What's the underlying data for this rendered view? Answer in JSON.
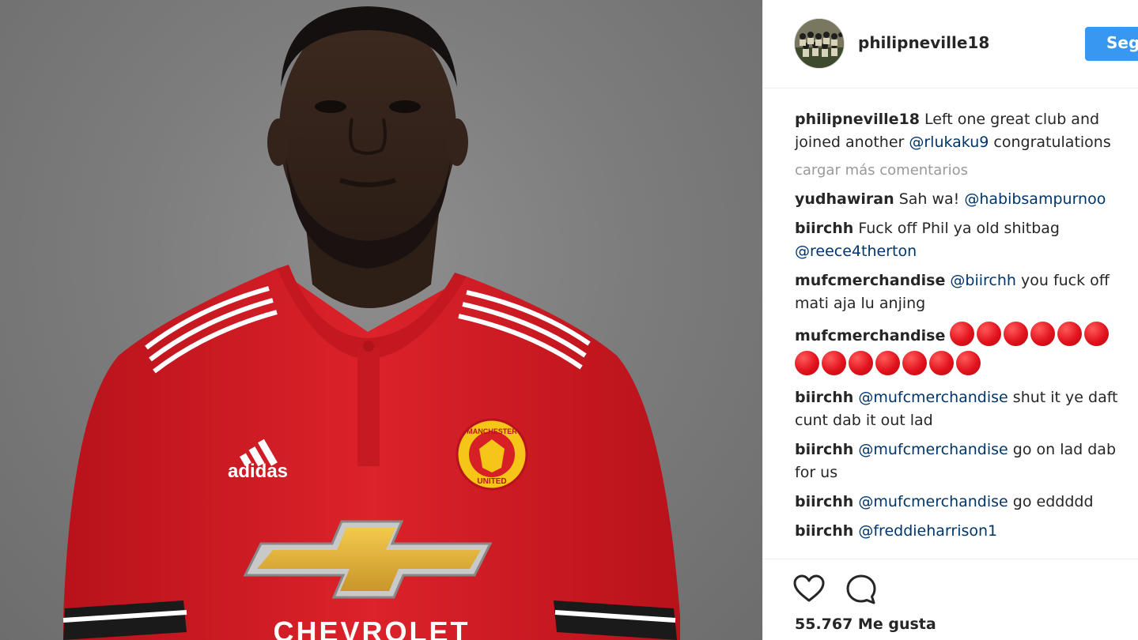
{
  "post": {
    "username": "philipneville18",
    "follow_label": "Seguir",
    "caption_text": " Left one great club and joined another ",
    "caption_mention": "@rlukaku9",
    "caption_tail": " congratulations",
    "load_more": "cargar más comentarios",
    "likes": "55.767 Me gusta"
  },
  "photo": {
    "shirt_brand": "adidas",
    "sponsor": "CHEVROLET",
    "crest_top": "MANCHESTER",
    "crest_bottom": "UNITED"
  },
  "comments": [
    {
      "user": "yudhawiran",
      "text": "Sah wa! ",
      "mention": "@habibsampurnoo",
      "tail": ""
    },
    {
      "user": "biirchh",
      "text": "Fuck off Phil ya old shitbag ",
      "mention": "@reece4therton",
      "tail": ""
    },
    {
      "user": "mufcmerchandise",
      "text": "",
      "mention": "@biirchh",
      "tail": " you fuck off mati aja lu anjing"
    },
    {
      "user": "mufcmerchandise",
      "emoji": "red-circle",
      "emoji_count": 13
    },
    {
      "user": "biirchh",
      "text": "",
      "mention": "@mufcmerchandise",
      "tail": " shut it ye daft cunt dab it out lad"
    },
    {
      "user": "biirchh",
      "text": "",
      "mention": "@mufcmerchandise",
      "tail": " go on lad dab for us"
    },
    {
      "user": "biirchh",
      "text": "",
      "mention": "@mufcmerchandise",
      "tail": " go eddddd"
    },
    {
      "user": "biirchh",
      "text": "",
      "mention": "@freddieharrison1",
      "tail": ""
    }
  ],
  "colors": {
    "follow_button": "#3897f0",
    "mention": "#003569",
    "muted": "#999999",
    "jersey_red": "#d71f26"
  },
  "icons": [
    "heart-icon",
    "speech-bubble-icon",
    "red-circle-emoji"
  ]
}
